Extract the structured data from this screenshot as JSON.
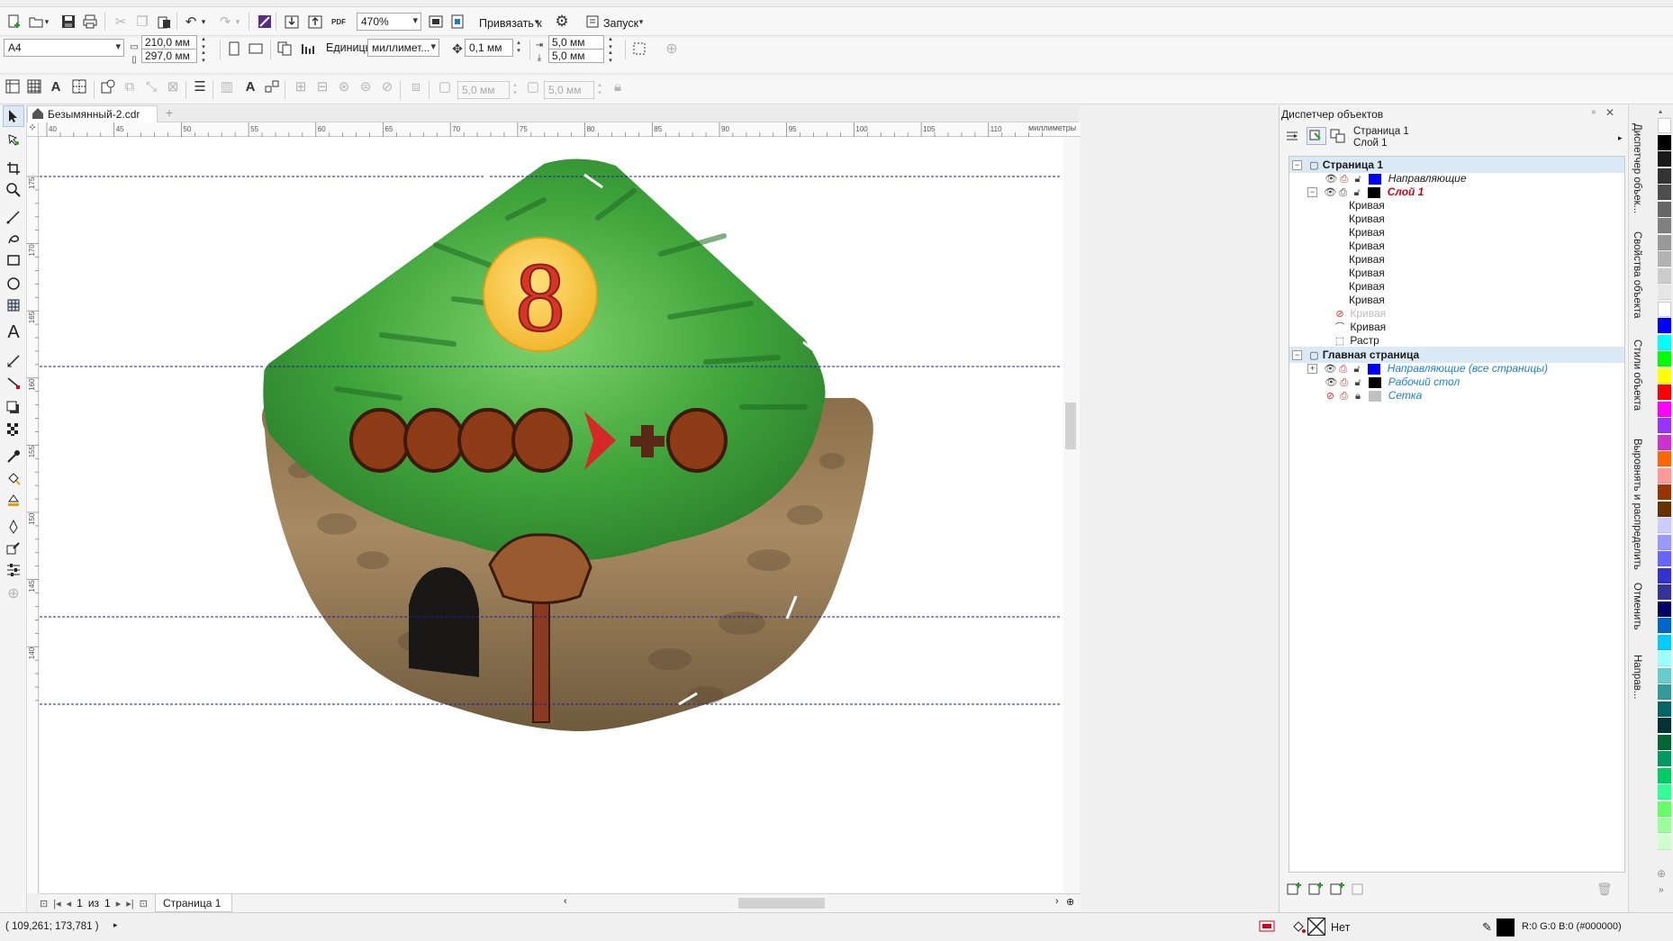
{
  "toolbar_main": {
    "zoom_value": "470%",
    "snap_label": "Привязать к",
    "launch_label": "Запуск",
    "pdf_label": "PDF"
  },
  "property_bar": {
    "page_size": "A4",
    "width": "210,0 мм",
    "height": "297,0 мм",
    "units_label": "Единицы:",
    "units_value": "миллимет...",
    "nudge": "0,1 мм",
    "dup_x": "5,0 мм",
    "dup_y": "5,0 мм"
  },
  "toolbar_row3": {
    "field_a": "5,0 мм",
    "field_b": "5,0 мм"
  },
  "document_tab": {
    "name": "Безымянный-2.cdr"
  },
  "ruler": {
    "h_ticks": [
      "40",
      "45",
      "50",
      "55",
      "60",
      "65",
      "70",
      "75",
      "80",
      "85",
      "90",
      "95",
      "100",
      "105",
      "110"
    ],
    "h_unit": "миллиметры",
    "v_ticks": [
      "175",
      "170",
      "165",
      "160",
      "155",
      "150",
      "145",
      "140"
    ]
  },
  "page_nav": {
    "current": "1",
    "of_label": "из",
    "total": "1",
    "page_tab": "Страница 1"
  },
  "status": {
    "coords": "( 109,261; 173,781 )",
    "fill_label": "Нет",
    "outline_color": "R:0 G:0 B:0 (#000000)"
  },
  "artwork": {
    "number": "8"
  },
  "docker": {
    "title": "Диспетчер объектов",
    "current_page": "Страница 1",
    "current_layer": "Слой 1",
    "tree": {
      "page1": "Страница 1",
      "guides": "Направляющие",
      "layer1": "Слой 1",
      "curves": [
        "Кривая",
        "Кривая",
        "Кривая",
        "Кривая",
        "Кривая",
        "Кривая",
        "Кривая",
        "Кривая"
      ],
      "curve_hidden": "Кривая",
      "curve_last": "Кривая",
      "raster": "Растр",
      "master_page": "Главная страница",
      "master_guides": "Направляющие (все страницы)",
      "desktop": "Рабочий стол",
      "grid": "Сетка"
    },
    "colors": {
      "guides_swatch": "#0000ff",
      "layer_swatch": "#000000",
      "grid_swatch": "#c0c0c0",
      "layer_text": "#d0021b",
      "master_text": "#1a7fd4"
    }
  },
  "vertical_tabs": [
    "Диспетчер объек...",
    "Свойства объекта",
    "Стили объекта",
    "Выровнять и распределить",
    "Отменить",
    "Направ..."
  ],
  "palette_colors": [
    "#ffffff",
    "#000000",
    "#1a1a1a",
    "#333333",
    "#4d4d4d",
    "#666666",
    "#808080",
    "#999999",
    "#b3b3b3",
    "#cccccc",
    "#e6e6e6",
    "#ffffff",
    "#0000ff",
    "#00ffff",
    "#00ff00",
    "#ffff00",
    "#ff0000",
    "#ff00ff",
    "#9933ff",
    "#cc33cc",
    "#ff6600",
    "#ff9999",
    "#993300",
    "#663300",
    "#ccccff",
    "#9999ff",
    "#6666ff",
    "#3333cc",
    "#333399",
    "#000066",
    "#0066cc",
    "#00ccff",
    "#99ffff",
    "#66cccc",
    "#339999",
    "#006666",
    "#003333",
    "#006633",
    "#009966",
    "#00cc66",
    "#33ff99",
    "#66ff66",
    "#99ff99",
    "#ccffcc"
  ]
}
